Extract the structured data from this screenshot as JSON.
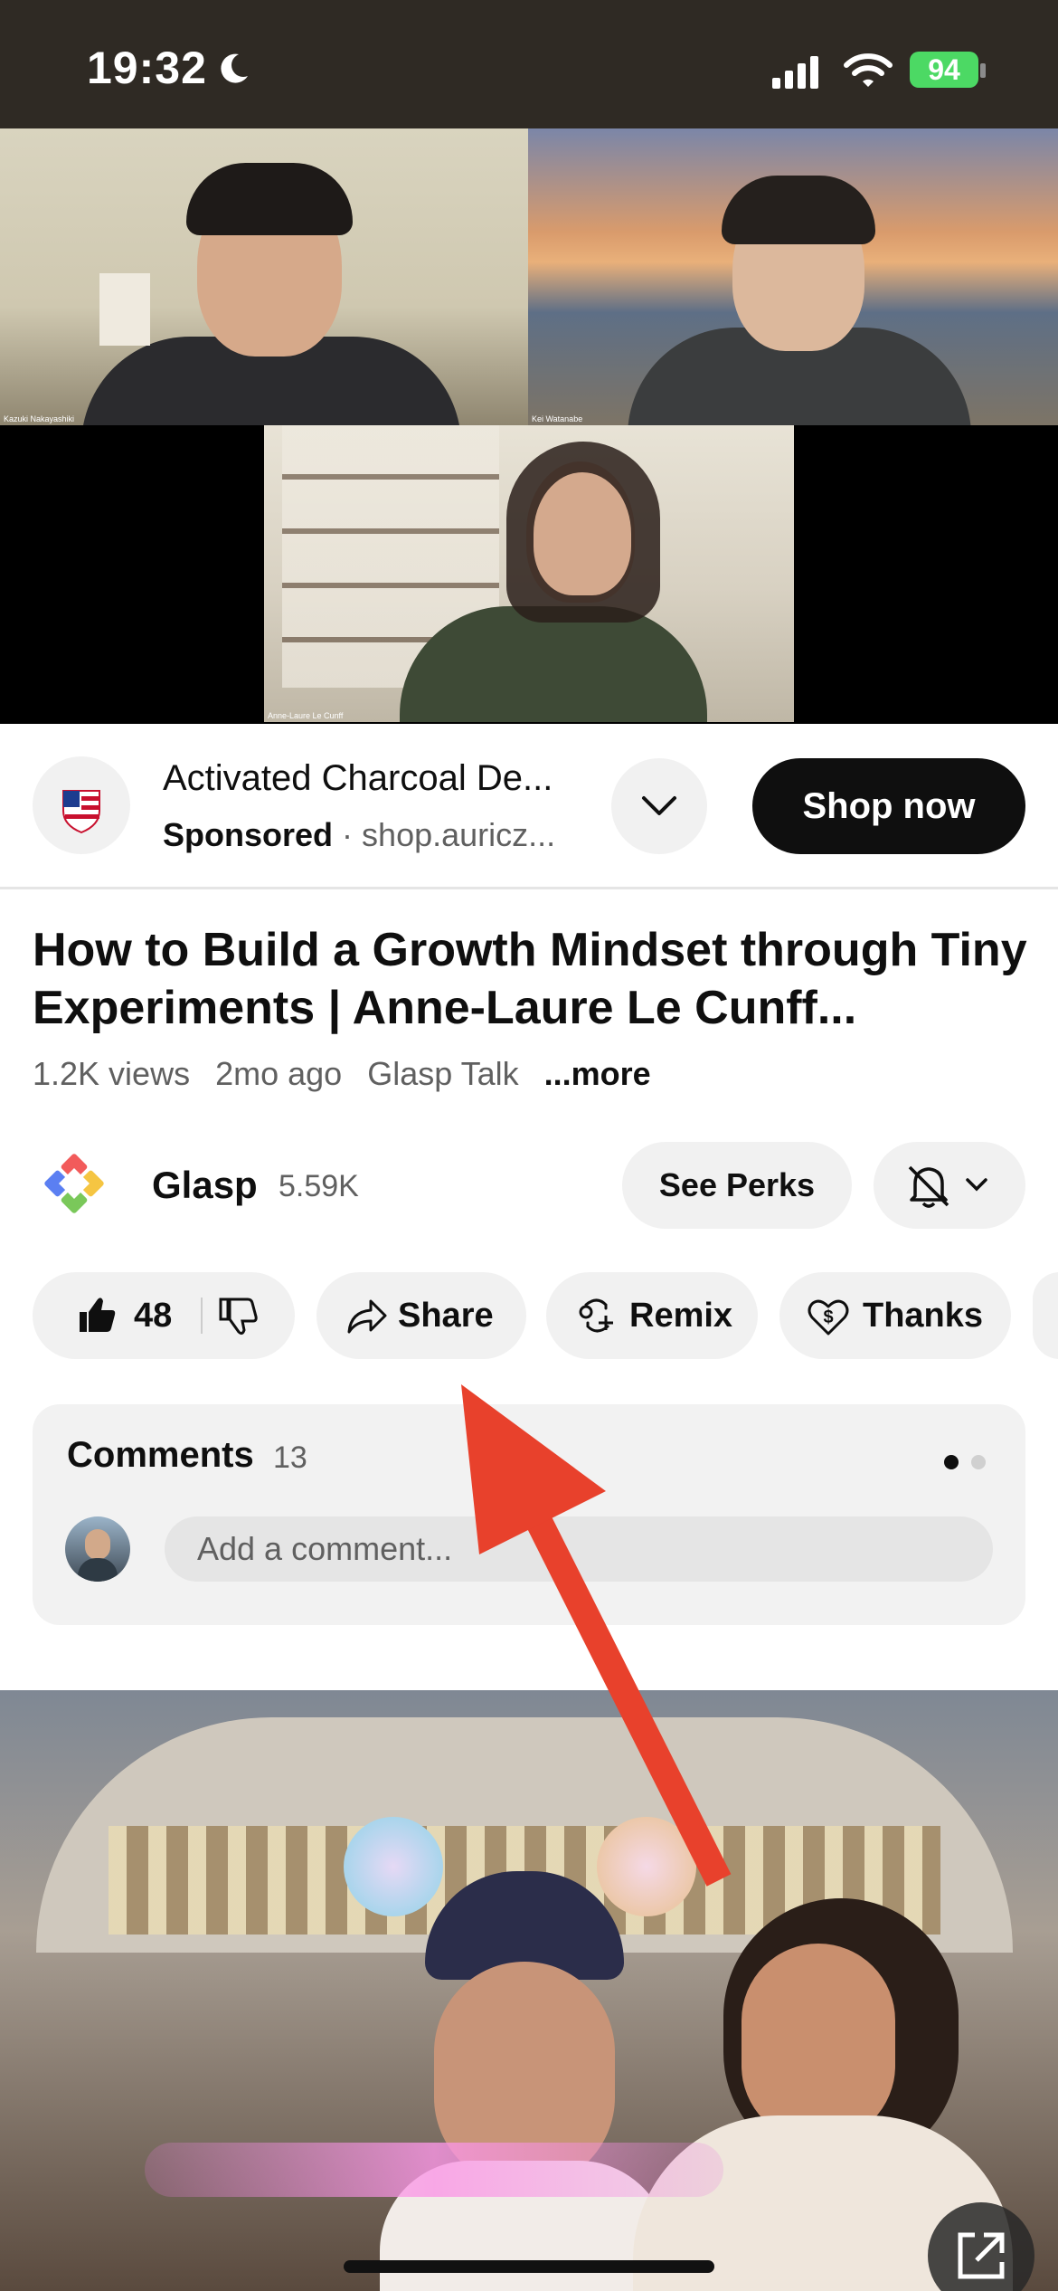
{
  "status_bar": {
    "time": "19:32",
    "battery": "94"
  },
  "video": {
    "participants": [
      {
        "name": "Kazuki Nakayashiki"
      },
      {
        "name": "Kei Watanabe"
      },
      {
        "name": "Anne-Laure Le Cunff"
      }
    ]
  },
  "ad": {
    "title": "Activated Charcoal De...",
    "sponsored": "Sponsored",
    "separator": "·",
    "domain": "shop.auricz...",
    "cta": "Shop now"
  },
  "video_info": {
    "title": "How to Build a Growth Mindset through Tiny Experiments | Anne-Laure Le Cunff...",
    "views": "1.2K views",
    "age": "2mo ago",
    "tag": "Glasp Talk",
    "more": "...more"
  },
  "channel": {
    "name": "Glasp",
    "subscribers": "5.59K",
    "perks_label": "See Perks"
  },
  "actions": {
    "likes": "48",
    "share": "Share",
    "remix": "Remix",
    "thanks": "Thanks"
  },
  "comments": {
    "title": "Comments",
    "count": "13",
    "placeholder": "Add a comment..."
  },
  "colors": {
    "accent_arrow": "#e8412c",
    "battery": "#4cd964",
    "chip_bg": "#f1f1f1"
  }
}
